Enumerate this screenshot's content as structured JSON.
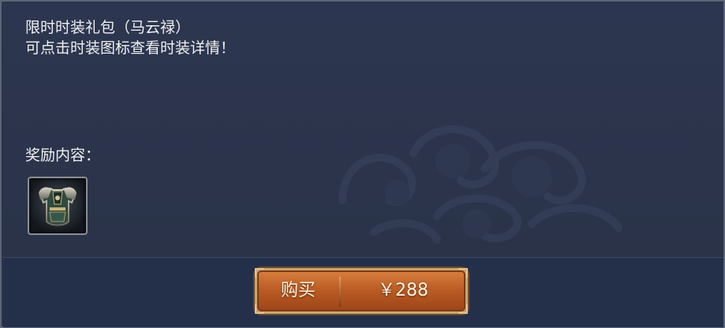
{
  "dialog": {
    "description_line1": "限时时装礼包（马云禄）",
    "description_line2": "可点击时装图标查看时装详情！",
    "reward_label": "奖励内容：",
    "reward_item_icon": "armor-icon"
  },
  "purchase": {
    "buy_label": "购买",
    "price": "￥288"
  },
  "colors": {
    "panel_bg": "#2b3449",
    "button_orange": "#b85a23",
    "button_border": "#c8a572",
    "text": "#f0f0f0"
  }
}
